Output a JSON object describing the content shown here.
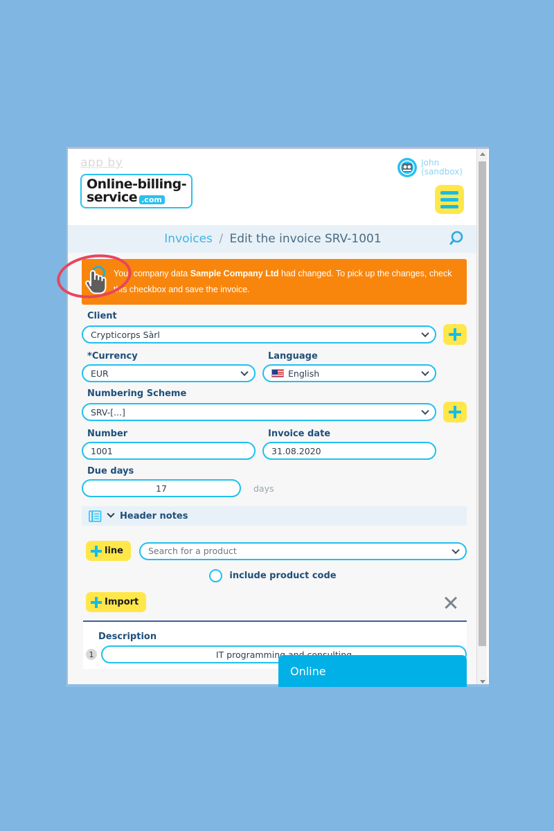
{
  "header": {
    "app_by": "app by",
    "logo_line1": "Online-billing-",
    "logo_line2": "service",
    "logo_tld": ".com",
    "user_name": "John",
    "user_mode": "(sandbox)"
  },
  "breadcrumb": {
    "parent": "Invoices",
    "separator": "/",
    "current": "Edit the invoice SRV-1001"
  },
  "alert": {
    "text_before": "Your company data ",
    "company": "Sample Company Ltd",
    "text_after": " had changed. To pick up the changes, check this checkbox and save the invoice."
  },
  "form": {
    "client_label": "Client",
    "client_value": "Crypticorps Sàrl",
    "currency_label": "Currency",
    "currency_required": "*",
    "currency_value": "EUR",
    "language_label": "Language",
    "language_value": "English",
    "numbering_label": "Numbering Scheme",
    "numbering_value": "SRV-[...]",
    "number_label": "Number",
    "number_value": "1001",
    "invoice_date_label": "Invoice date",
    "invoice_date_value": "31.08.2020",
    "due_days_label": "Due days",
    "due_days_value": "17",
    "due_days_suffix": "days",
    "header_notes_label": "Header notes"
  },
  "products": {
    "add_line_label": "line",
    "search_placeholder": "Search for a product",
    "include_code_label": "include product code",
    "import_label": "Import",
    "description_label": "Description",
    "line_number": "1",
    "line_description": "IT programming and consulting"
  },
  "tooltip": {
    "label": "Online"
  },
  "colors": {
    "page_background": "#7FB6E2",
    "alert_orange": "#F8860D",
    "accent_cyan": "#1EC0F0",
    "accent_yellow": "#FFE74A",
    "label_blue": "#1F4F7A",
    "annotation_red": "#E8455E",
    "tooltip_blue": "#00B0E6"
  }
}
